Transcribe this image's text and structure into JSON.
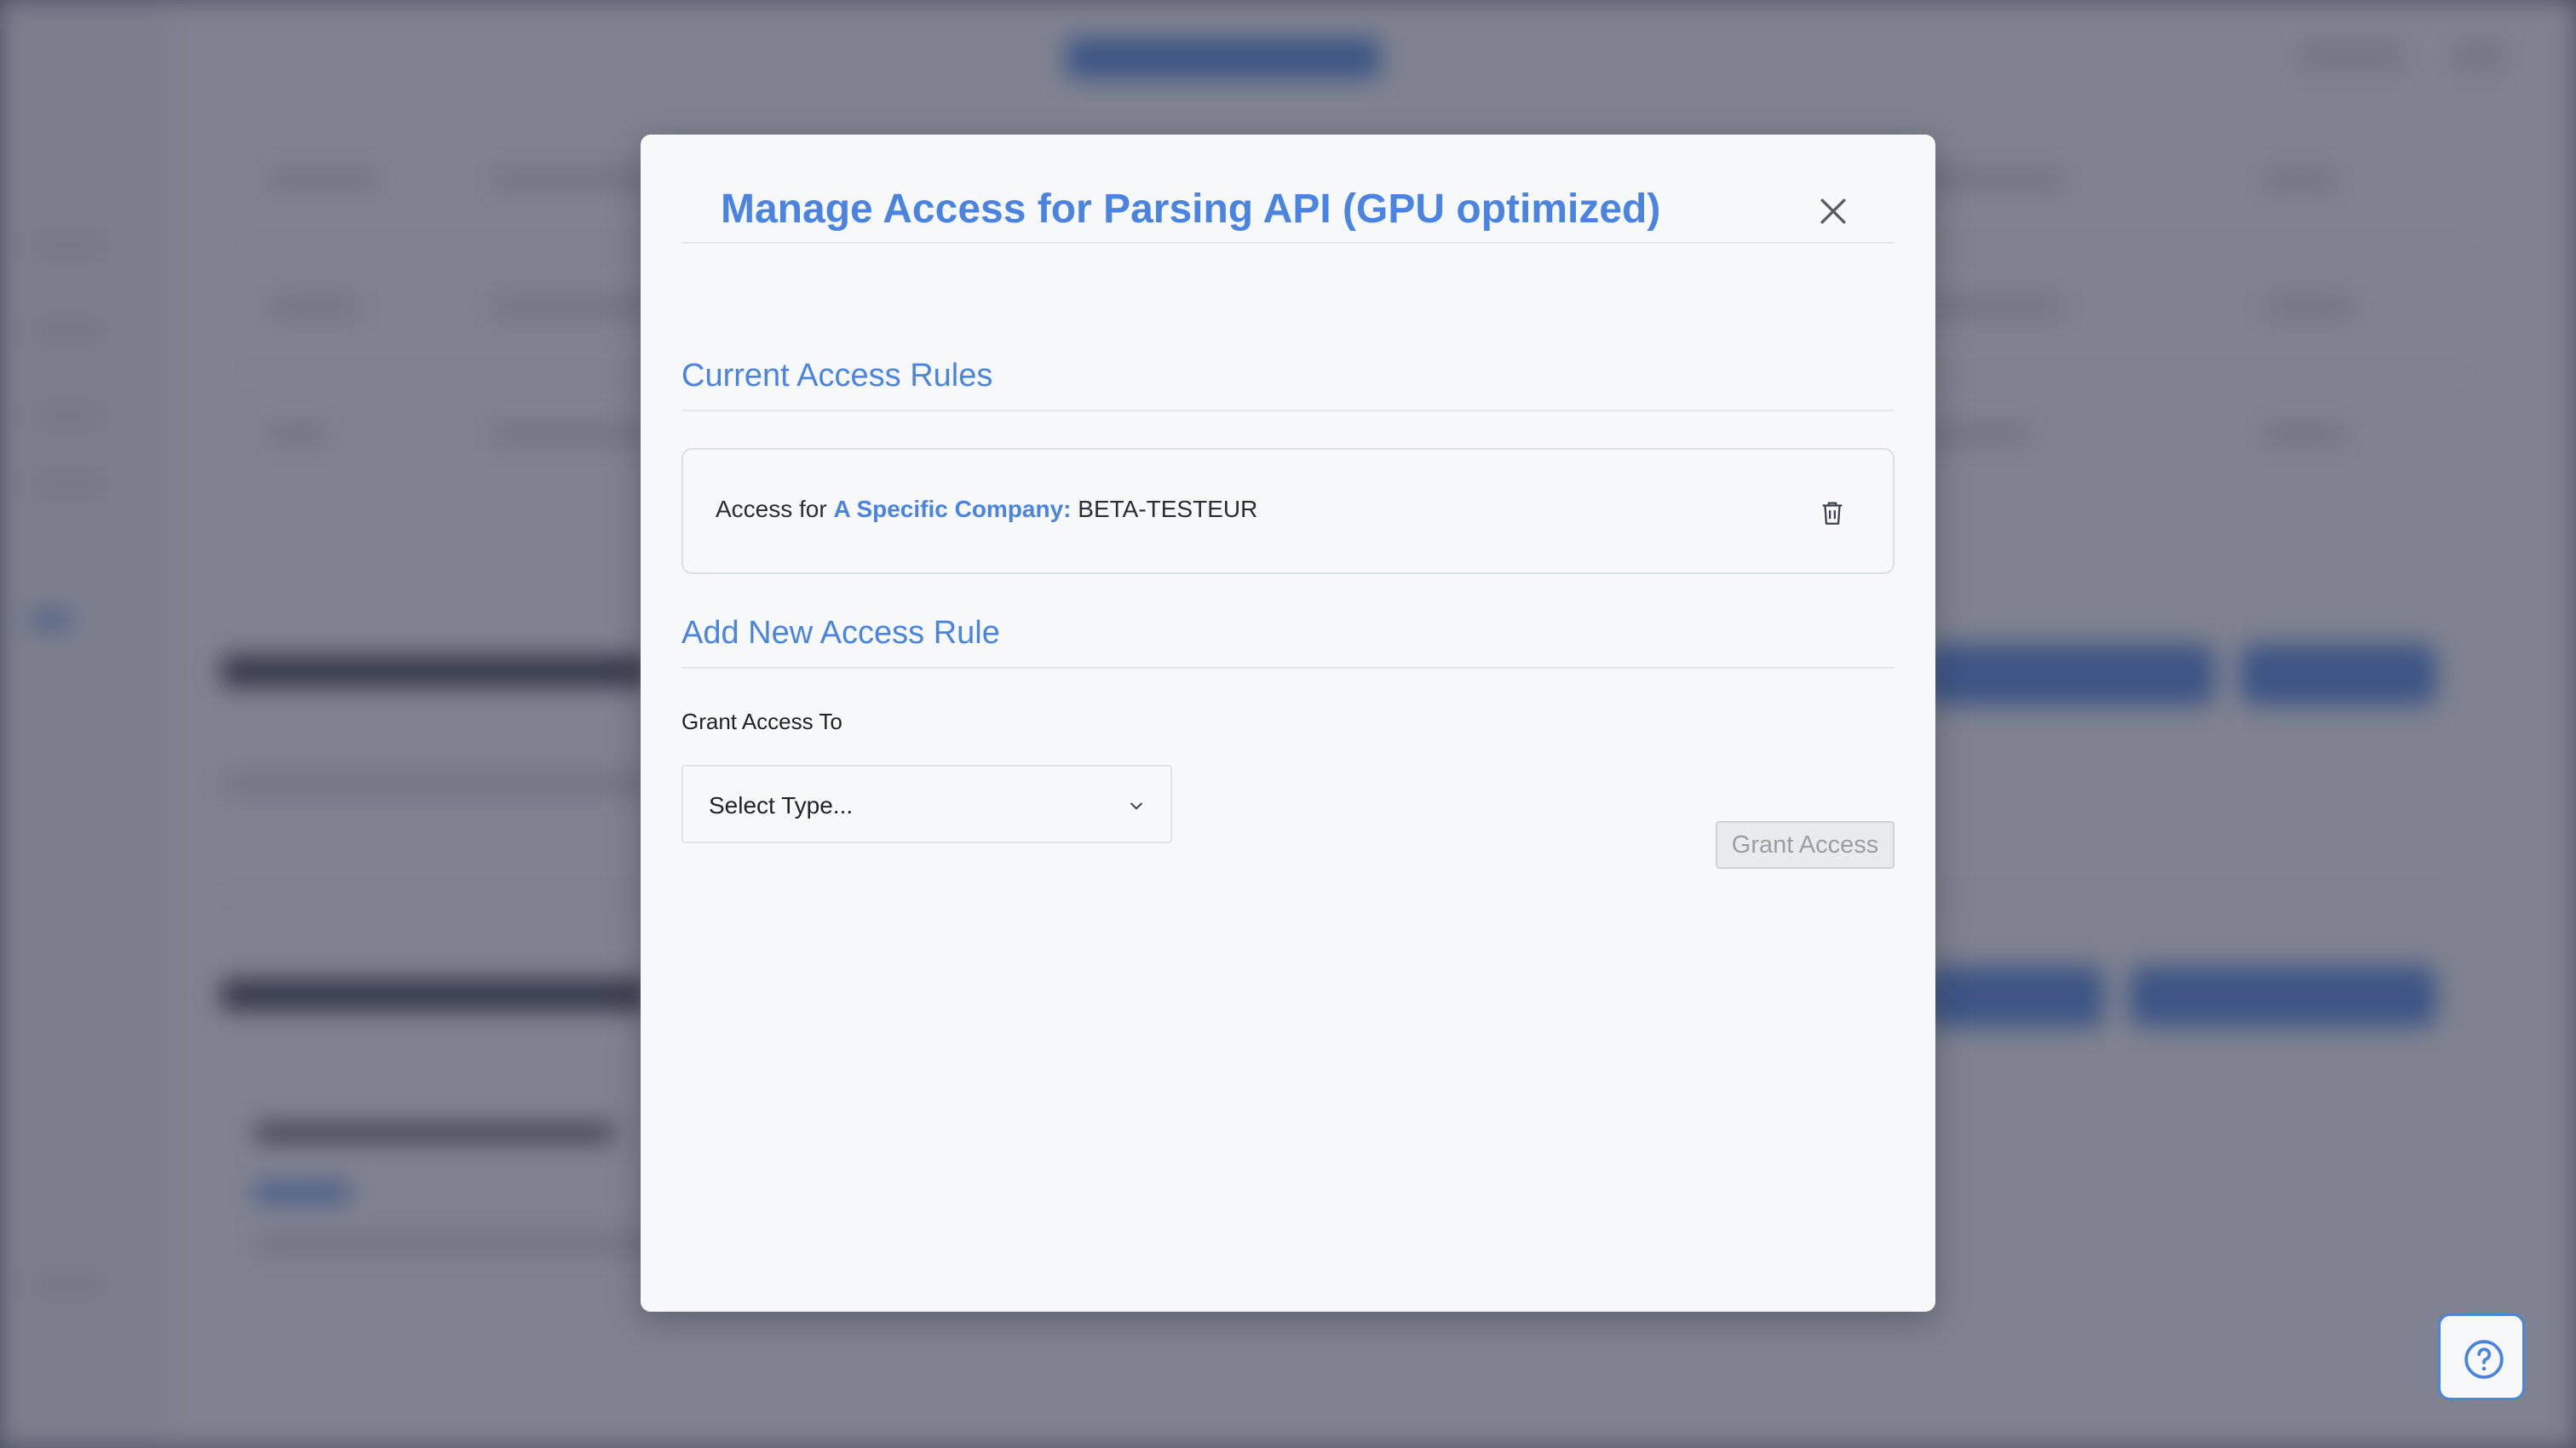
{
  "modal": {
    "title": "Manage Access for Parsing API (GPU optimized)",
    "close_icon": "close-icon"
  },
  "current_rules": {
    "heading": "Current Access Rules",
    "rules": [
      {
        "prefix": "Access for ",
        "type": "A Specific Company:",
        "value": " BETA-TESTEUR",
        "delete_icon": "trash-icon"
      }
    ]
  },
  "add_rule": {
    "heading": "Add New Access Rule",
    "grant_label": "Grant Access To",
    "select_value": "Select Type...",
    "select_icon": "chevron-down-icon",
    "grant_button": "Grant Access",
    "grant_button_disabled": true
  },
  "help": {
    "icon": "help-circle-icon"
  },
  "colors": {
    "accent": "#4a84e0",
    "overlay": "#373c50",
    "modal_bg": "#f7f8fa"
  }
}
